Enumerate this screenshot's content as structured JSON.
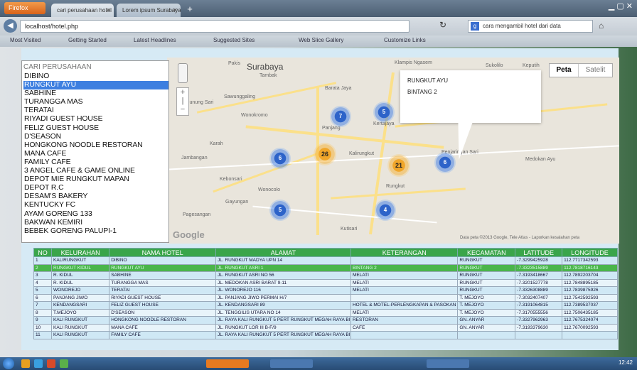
{
  "browser": {
    "app_button": "Firefox",
    "tabs": [
      {
        "label": "cari perusahaan hotel"
      },
      {
        "label": "Lorem ipsum Surabaya"
      }
    ],
    "url": "localhost/hotel.php",
    "search_value": "cara mengambil hotel dari data",
    "bookmarks": [
      "Most Visited",
      "Getting Started",
      "Latest Headlines",
      "Suggested Sites",
      "Web Slice Gallery",
      "Customize Links"
    ]
  },
  "sidebar": {
    "search_placeholder": "CARI PERUSAHAAN",
    "items": [
      {
        "label": "DIBINO"
      },
      {
        "label": "RUNGKUT AYU"
      },
      {
        "label": "SABHINE"
      },
      {
        "label": "TURANGGA MAS"
      },
      {
        "label": "TERATAI"
      },
      {
        "label": "RIYADI GUEST HOUSE"
      },
      {
        "label": "FELIZ GUEST HOUSE"
      },
      {
        "label": "D'SEASON"
      },
      {
        "label": "HONGKONG NOODLE RESTORAN"
      },
      {
        "label": "MANA CAFE"
      },
      {
        "label": "FAMILY CAFE"
      },
      {
        "label": "3 ANGEL CAFE & GAME ONLINE"
      },
      {
        "label": "DEPOT MIE RUNGKUT MAPAN"
      },
      {
        "label": "DEPOT R.C"
      },
      {
        "label": "DESAM'S BAKERY"
      },
      {
        "label": "KENTUCKY FC"
      },
      {
        "label": "AYAM GORENG 133"
      },
      {
        "label": "BAKWAN KEMIRI"
      },
      {
        "label": "BEBEK GORENG PALUPI-1"
      }
    ]
  },
  "map": {
    "maptype_peta": "Peta",
    "maptype_satelit": "Satelit",
    "infowindow": {
      "name": "RUNGKUT AYU",
      "address": "BINTANG 2"
    },
    "clusters": [
      "7",
      "5",
      "6",
      "26",
      "21",
      "6",
      "5",
      "4"
    ],
    "labels": [
      "Surabaya",
      "Pakis",
      "Tambak",
      "Barata Jaya",
      "Gunung Sari",
      "Sawunggaling",
      "Wonokromo",
      "Kertajaya",
      "Panjang",
      "Jambangan",
      "Karah",
      "Kebonsari",
      "Wonocolo",
      "Gayungan",
      "Pagesangan",
      "Kutisari",
      "Rungkut",
      "Kalirungkut",
      "Medokan Ayu",
      "Penjaringan Sari",
      "Klampis Ngasem",
      "Sukolilo",
      "Keputih"
    ],
    "google": "Google",
    "attribution": "Data peta ©2013 Google, Tele Atlas - Laporkan kesalahan peta"
  },
  "table": {
    "headers": [
      "NO",
      "KELURAHAN",
      "NAMA HOTEL",
      "ALAMAT",
      "KETERANGAN",
      "KECAMATAN",
      "LATITUDE",
      "LONGITUDE"
    ],
    "rows": [
      [
        "1",
        "KALIRUNGKUT",
        "DIBINO",
        "JL. RUNGKUT MADYA UPN 14",
        "",
        "RUNGKUT",
        "-7.3299425928",
        "112.7717342593"
      ],
      [
        "2",
        "RUNGKUT KIDUL",
        "RUNGKUT AYU",
        "JL. RUNGKUT ASRI 1",
        "BINTANG 2",
        "RUNGKUT",
        "-7.3323515889",
        "112.7818716143"
      ],
      [
        "3",
        "R. KIDUL",
        "SABHINE",
        "JL. RUNGKUT ASRI NO 56",
        "MELATI",
        "RUNGKUT",
        "-7.3193418667",
        "112.7892203704"
      ],
      [
        "4",
        "R. KIDUL",
        "TURANGGA MAS",
        "JL. MEDOKAN ASRI BARAT 9-11",
        "MELATI",
        "RUNGKUT",
        "-7.3201527778",
        "112.7848895185"
      ],
      [
        "5",
        "WONOREJO",
        "TERATAI",
        "JL. WONOREJO 116",
        "MELATI",
        "RUNGKUT",
        "-7.3326308889",
        "112.7839875926"
      ],
      [
        "6",
        "PANJANG JIWO",
        "RIYADI GUEST HOUSE",
        "JL. PANJANG JIWO PERMAI H/7",
        "",
        "T. MEJOYO",
        "-7.3032407407",
        "112.7542592593"
      ],
      [
        "7",
        "KENDANGSARI",
        "FELIZ GUEST HOUSE",
        "JL. KENDANGSARI 89",
        "HOTEL & MOTEL-PERLENGKAPAN & PASOKAN",
        "T. MEJOYO",
        "-7.3191064815",
        "112.7389537037"
      ],
      [
        "8",
        "T.MEJOYO",
        "D'SEASON",
        "JL. TENGGILIS UTARA NO 14",
        "MELATI",
        "T. MEJOYO",
        "-7.3170555556",
        "112.7506435185"
      ],
      [
        "9",
        "KALI RUNGKUT",
        "HONGKONG NOODLE RESTORAN",
        "JL. RAYA KALI RUNGKUT 5 PERT RUNGKUT MEGAH RAYA BI 142",
        "RESTORAN",
        "GN. ANYAR",
        "-7.3327962963",
        "112.7675324074"
      ],
      [
        "10",
        "KALI RUNGKUT",
        "MANA CAFE",
        "JL. RUNGKUT LOR III B-F/9",
        "CAFE",
        "GN. ANYAR",
        "-7.3193379630",
        "112.7670092593"
      ],
      [
        "11",
        "KALI RUNGKUT",
        "FAMILY CAFE",
        "JL. RAYA KALI RUNGKUT 5 PERT RUNGKUT MEGAH RAYA BI",
        "",
        "",
        "",
        ""
      ]
    ]
  },
  "taskbar": {
    "clock": "12:42"
  }
}
